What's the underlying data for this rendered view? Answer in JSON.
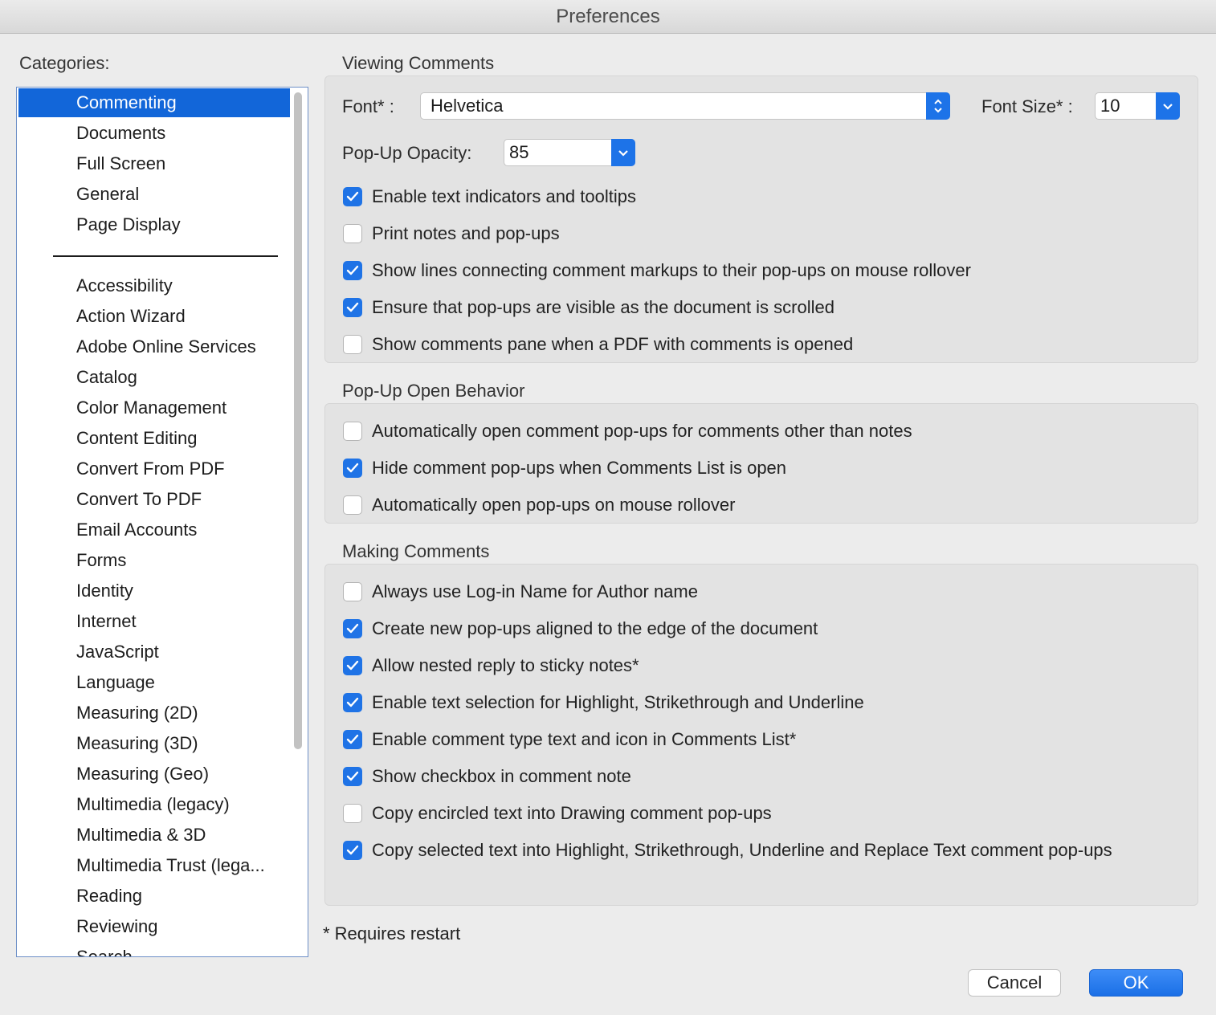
{
  "window": {
    "title": "Preferences"
  },
  "categories": {
    "label": "Categories:",
    "top": [
      {
        "label": "Commenting",
        "selected": true
      },
      {
        "label": "Documents"
      },
      {
        "label": "Full Screen"
      },
      {
        "label": "General"
      },
      {
        "label": "Page Display"
      }
    ],
    "rest": [
      {
        "label": "Accessibility"
      },
      {
        "label": "Action Wizard"
      },
      {
        "label": "Adobe Online Services"
      },
      {
        "label": "Catalog"
      },
      {
        "label": "Color Management"
      },
      {
        "label": "Content Editing"
      },
      {
        "label": "Convert From PDF"
      },
      {
        "label": "Convert To PDF"
      },
      {
        "label": "Email Accounts"
      },
      {
        "label": "Forms"
      },
      {
        "label": "Identity"
      },
      {
        "label": "Internet"
      },
      {
        "label": "JavaScript"
      },
      {
        "label": "Language"
      },
      {
        "label": "Measuring (2D)"
      },
      {
        "label": "Measuring (3D)"
      },
      {
        "label": "Measuring (Geo)"
      },
      {
        "label": "Multimedia (legacy)"
      },
      {
        "label": "Multimedia & 3D"
      },
      {
        "label": "Multimedia Trust (lega..."
      },
      {
        "label": "Reading"
      },
      {
        "label": "Reviewing"
      },
      {
        "label": "Search"
      }
    ]
  },
  "viewing": {
    "title": "Viewing Comments",
    "font_label": "Font* :",
    "font_value": "Helvetica",
    "font_size_label": "Font Size* :",
    "font_size_value": "10",
    "opacity_label": "Pop-Up Opacity:",
    "opacity_value": "85",
    "options": [
      {
        "label": "Enable text indicators and tooltips",
        "checked": true
      },
      {
        "label": "Print notes and pop-ups",
        "checked": false
      },
      {
        "label": "Show lines connecting comment markups to their pop-ups on mouse rollover",
        "checked": true
      },
      {
        "label": "Ensure that pop-ups are visible as the document is scrolled",
        "checked": true
      },
      {
        "label": "Show comments pane when a PDF with comments is opened",
        "checked": false
      }
    ]
  },
  "popup": {
    "title": "Pop-Up Open Behavior",
    "options": [
      {
        "label": "Automatically open comment pop-ups for comments other than notes",
        "checked": false
      },
      {
        "label": "Hide comment pop-ups when Comments List is open",
        "checked": true
      },
      {
        "label": "Automatically open pop-ups on mouse rollover",
        "checked": false
      }
    ]
  },
  "making": {
    "title": "Making Comments",
    "options": [
      {
        "label": "Always use Log-in Name for Author name",
        "checked": false
      },
      {
        "label": "Create new pop-ups aligned to the edge of the document",
        "checked": true
      },
      {
        "label": "Allow nested reply to sticky notes*",
        "checked": true
      },
      {
        "label": "Enable text selection for Highlight, Strikethrough and Underline",
        "checked": true
      },
      {
        "label": "Enable comment type text and icon in Comments List*",
        "checked": true
      },
      {
        "label": "Show checkbox in comment note",
        "checked": true
      },
      {
        "label": "Copy encircled text into Drawing comment pop-ups",
        "checked": false
      },
      {
        "label": "Copy selected text into Highlight, Strikethrough, Underline and Replace Text comment pop-ups",
        "checked": true
      }
    ]
  },
  "footnote": "* Requires restart",
  "buttons": {
    "cancel": "Cancel",
    "ok": "OK"
  },
  "colors": {
    "accent": "#1f73e6",
    "selection": "#1266d9"
  }
}
